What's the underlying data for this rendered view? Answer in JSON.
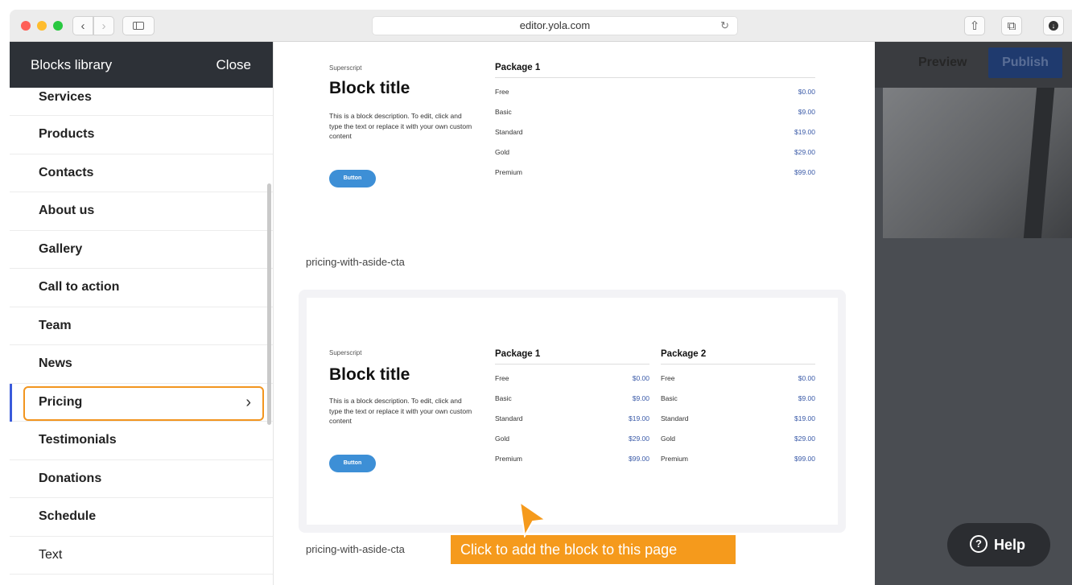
{
  "browser": {
    "url": "editor.yola.com",
    "reload_icon": "reload-icon",
    "back_glyph": "‹",
    "forward_glyph": "›",
    "share_glyph": "⇧",
    "tabs_glyph": "⧉",
    "download_glyph": "⬇"
  },
  "sidebar": {
    "title": "Blocks library",
    "close_label": "Close",
    "items": [
      {
        "label": "Services"
      },
      {
        "label": "Products"
      },
      {
        "label": "Contacts"
      },
      {
        "label": "About us"
      },
      {
        "label": "Gallery"
      },
      {
        "label": "Call to action"
      },
      {
        "label": "Team"
      },
      {
        "label": "News"
      },
      {
        "label": "Pricing",
        "active": true
      },
      {
        "label": "Testimonials"
      },
      {
        "label": "Donations"
      },
      {
        "label": "Schedule"
      },
      {
        "label": "Text"
      }
    ],
    "active_chevron": "›"
  },
  "preview": {
    "block1": {
      "superscript": "Superscript",
      "title": "Block title",
      "description": "This is a block description. To edit, click and type the text or replace it with your own custom content",
      "button": "Button",
      "packages": [
        {
          "name": "Package 1",
          "rows": [
            {
              "name": "Free",
              "price": "$0.00"
            },
            {
              "name": "Basic",
              "price": "$9.00"
            },
            {
              "name": "Standard",
              "price": "$19.00"
            },
            {
              "name": "Gold",
              "price": "$29.00"
            },
            {
              "name": "Premium",
              "price": "$99.00"
            }
          ]
        }
      ]
    },
    "label1": "pricing-with-aside-cta",
    "block2": {
      "superscript": "Superscript",
      "title": "Block title",
      "description": "This is a block description. To edit, click and type the text or replace it with your own custom content",
      "button": "Button",
      "packages": [
        {
          "name": "Package 1",
          "rows": [
            {
              "name": "Free",
              "price": "$0.00"
            },
            {
              "name": "Basic",
              "price": "$9.00"
            },
            {
              "name": "Standard",
              "price": "$19.00"
            },
            {
              "name": "Gold",
              "price": "$29.00"
            },
            {
              "name": "Premium",
              "price": "$99.00"
            }
          ]
        },
        {
          "name": "Package 2",
          "rows": [
            {
              "name": "Free",
              "price": "$0.00"
            },
            {
              "name": "Basic",
              "price": "$9.00"
            },
            {
              "name": "Standard",
              "price": "$19.00"
            },
            {
              "name": "Gold",
              "price": "$29.00"
            },
            {
              "name": "Premium",
              "price": "$99.00"
            }
          ]
        }
      ]
    },
    "label2": "pricing-with-aside-cta",
    "tooltip": "Click to add the block to this page"
  },
  "topbar": {
    "preview_label": "Preview",
    "publish_label": "Publish"
  },
  "help": {
    "label": "Help",
    "icon_glyph": "?"
  },
  "colors": {
    "accent_orange": "#f59a1c",
    "sidebar_header": "#2d3137",
    "active_bar": "#3b5bdb",
    "cta_blue": "#3d8fd6",
    "publish_navy": "#1f3a6e"
  }
}
